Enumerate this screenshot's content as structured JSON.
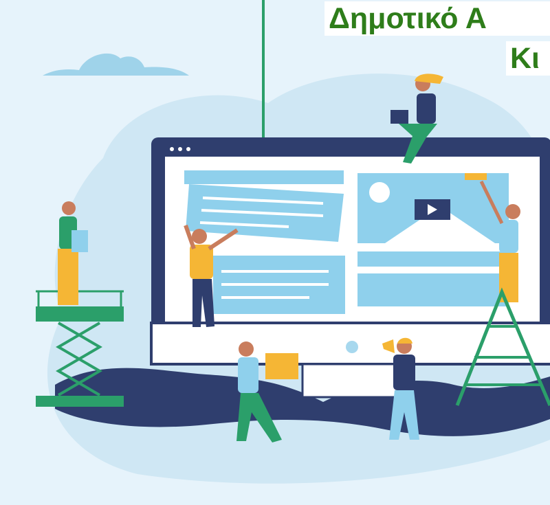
{
  "heading": {
    "line1": "Δημοτικό Α",
    "line2": "Κι"
  },
  "colors": {
    "background": "#e6f3fb",
    "title_text": "#2e7d1a",
    "monitor_frame": "#2f3e6e",
    "screen_panel": "#8fd0ec",
    "accent_green": "#2b9f6a",
    "accent_yellow": "#f5b635"
  }
}
